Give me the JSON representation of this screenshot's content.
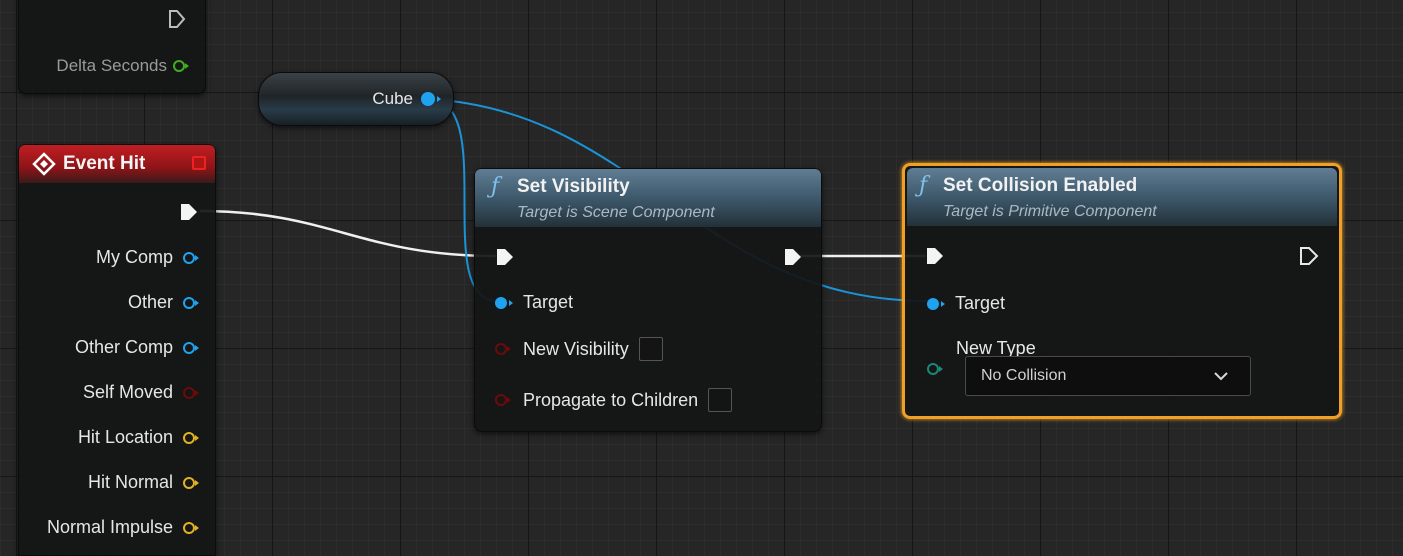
{
  "top_node": {
    "delta_label": "Delta Seconds"
  },
  "cube_node": {
    "label": "Cube"
  },
  "event_hit": {
    "title": "Event Hit",
    "pins": [
      {
        "label": "My Comp",
        "color": "blue"
      },
      {
        "label": "Other",
        "color": "blue"
      },
      {
        "label": "Other Comp",
        "color": "blue"
      },
      {
        "label": "Self Moved",
        "color": "red"
      },
      {
        "label": "Hit Location",
        "color": "yellow"
      },
      {
        "label": "Hit Normal",
        "color": "yellow"
      },
      {
        "label": "Normal Impulse",
        "color": "yellow"
      }
    ]
  },
  "set_visibility": {
    "title": "Set Visibility",
    "subtitle": "Target is Scene Component",
    "target_label": "Target",
    "new_visibility_label": "New Visibility",
    "propagate_label": "Propagate to Children"
  },
  "set_collision": {
    "title": "Set Collision Enabled",
    "subtitle": "Target is Primitive Component",
    "target_label": "Target",
    "new_type_label": "New Type",
    "dropdown_value": "No Collision"
  },
  "colors": {
    "object_pin": "#1fa3f0",
    "bool_pin": "#6b0b0b",
    "vector_pin": "#e1b222",
    "float_pin": "#3fae20",
    "enum_pin": "#1a8878",
    "selection": "#f0a024",
    "event_header": "#a3171a"
  }
}
